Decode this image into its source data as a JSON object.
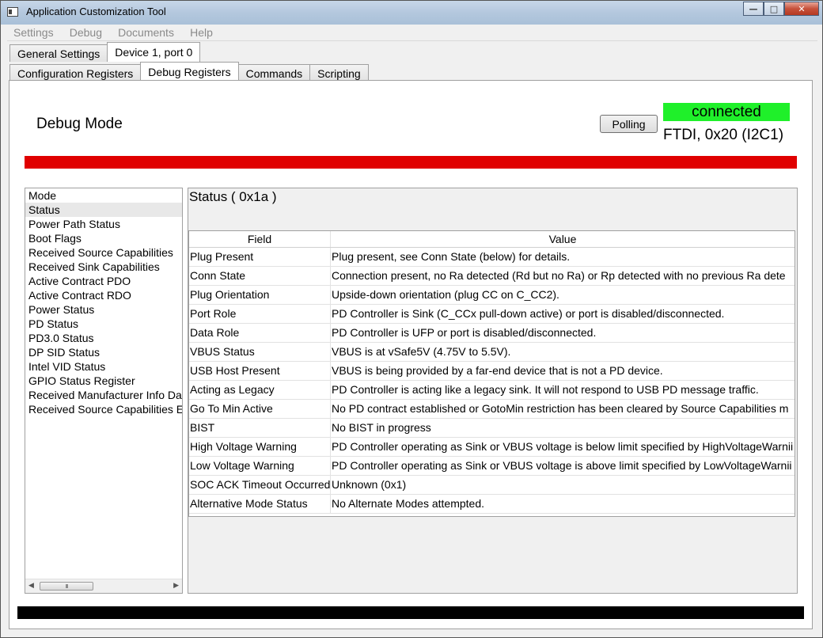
{
  "window": {
    "title": "Application Customization Tool",
    "controls": {
      "minimize": "—",
      "maximize": "□",
      "close": "✕"
    }
  },
  "menu": [
    "Settings",
    "Debug",
    "Documents",
    "Help"
  ],
  "top_tabs": [
    {
      "label": "General Settings",
      "active": false
    },
    {
      "label": "Device 1, port 0",
      "active": true
    }
  ],
  "sub_tabs": [
    {
      "label": "Configuration Registers",
      "active": false
    },
    {
      "label": "Debug Registers",
      "active": true
    },
    {
      "label": "Commands",
      "active": false
    },
    {
      "label": "Scripting",
      "active": false
    }
  ],
  "header": {
    "title": "Debug Mode",
    "polling_label": "Polling",
    "connection_status": "connected",
    "connection_info": "FTDI, 0x20 (I2C1)"
  },
  "colors": {
    "status_bar": "#e00000",
    "connected": "#1ff02a",
    "bottom_bar": "#000000"
  },
  "register_list": [
    "Mode",
    "Status",
    "Power Path Status",
    "Boot Flags",
    "Received Source Capabilities",
    "Received Sink Capabilities",
    "Active Contract PDO",
    "Active Contract RDO",
    "Power Status",
    "PD Status",
    "PD3.0 Status",
    "DP SID Status",
    "Intel VID Status",
    "GPIO Status Register",
    "Received Manufacturer Info Da",
    "Received Source Capabilities E"
  ],
  "selected_register": "Status",
  "scrollbar": {
    "left_arrow": "◀",
    "right_arrow": "▶",
    "thumb_grip": "III"
  },
  "register": {
    "title": "Status  ( 0x1a )",
    "columns": [
      "Field",
      "Value"
    ],
    "rows": [
      [
        "Plug Present",
        "Plug present, see Conn State (below) for details."
      ],
      [
        "Conn State",
        "Connection present, no Ra detected (Rd but no Ra) or Rp detected with no previous Ra dete"
      ],
      [
        "Plug Orientation",
        "Upside-down orientation (plug CC on C_CC2)."
      ],
      [
        "Port Role",
        "PD Controller is Sink (C_CCx pull-down active) or port is disabled/disconnected."
      ],
      [
        "Data Role",
        "PD Controller is UFP or port is disabled/disconnected."
      ],
      [
        "VBUS Status",
        "VBUS is at vSafe5V (4.75V to 5.5V)."
      ],
      [
        "USB Host Present",
        "VBUS is being provided by a far-end device that is not a PD device."
      ],
      [
        "Acting as Legacy",
        "PD Controller is acting like a legacy sink. It will not respond to USB PD message traffic."
      ],
      [
        "Go To Min Active",
        "No PD contract established or GotoMin restriction has been cleared by Source Capabilities m"
      ],
      [
        "BIST",
        "No BIST in progress"
      ],
      [
        "High Voltage Warning",
        "PD Controller operating as Sink or VBUS voltage is below limit specified by HighVoltageWarnii"
      ],
      [
        "Low Voltage Warning",
        "PD Controller operating as Sink or VBUS voltage is above limit specified by LowVoltageWarnii"
      ],
      [
        "SOC ACK Timeout Occurred",
        "Unknown (0x1)"
      ],
      [
        "Alternative Mode Status",
        "No Alternate Modes attempted."
      ]
    ]
  }
}
